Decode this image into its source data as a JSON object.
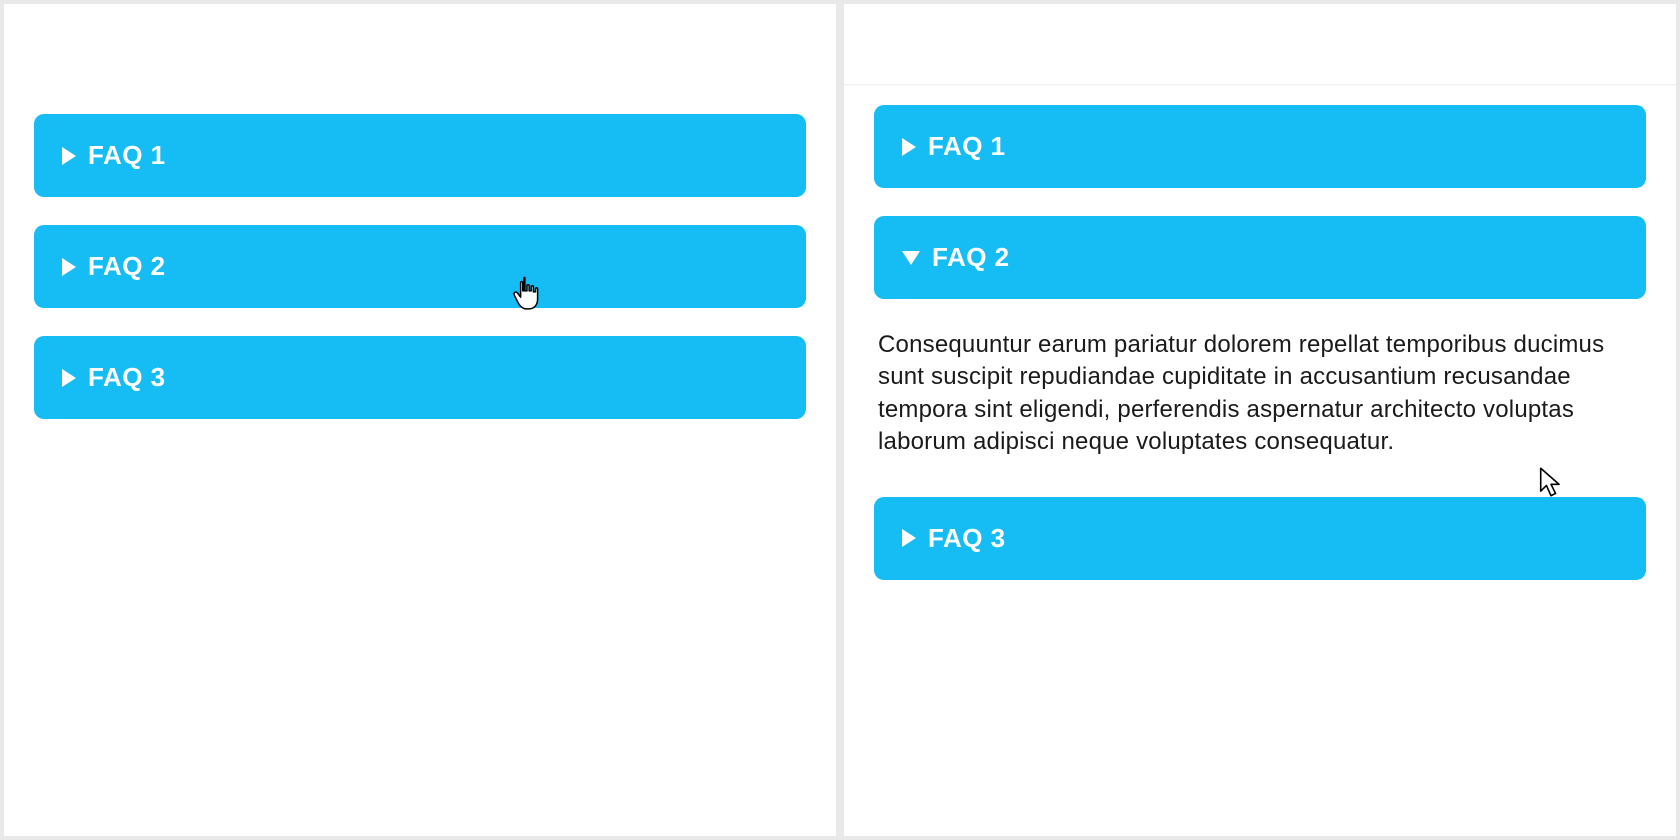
{
  "accent_color": "#15bdf4",
  "left": {
    "items": [
      {
        "label": "FAQ 1",
        "icon": "triangle-right",
        "expanded": false
      },
      {
        "label": "FAQ 2",
        "icon": "triangle-right",
        "expanded": false
      },
      {
        "label": "FAQ 3",
        "icon": "triangle-right",
        "expanded": false
      }
    ],
    "cursor": "hand-pointer"
  },
  "right": {
    "items": [
      {
        "label": "FAQ 1",
        "icon": "triangle-right",
        "expanded": false
      },
      {
        "label": "FAQ 2",
        "icon": "triangle-down",
        "expanded": true,
        "body": "Consequuntur earum pariatur dolorem repellat temporibus ducimus sunt suscipit repudiandae cupiditate in accusantium recusandae tempora sint eligendi, perferendis aspernatur architecto voluptas laborum adipisci neque voluptates consequatur."
      },
      {
        "label": "FAQ 3",
        "icon": "triangle-right",
        "expanded": false
      }
    ],
    "cursor": "arrow-pointer"
  }
}
